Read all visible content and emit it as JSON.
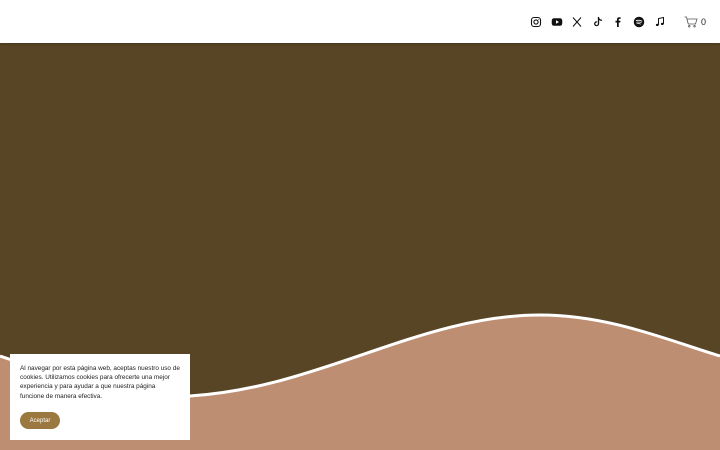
{
  "header": {
    "social_links": [
      {
        "icon": "instagram-icon"
      },
      {
        "icon": "youtube-icon"
      },
      {
        "icon": "x-twitter-icon"
      },
      {
        "icon": "tiktok-icon"
      },
      {
        "icon": "facebook-icon"
      },
      {
        "icon": "spotify-icon"
      },
      {
        "icon": "music-note-icon"
      }
    ],
    "cart": {
      "icon": "cart-icon",
      "count": "0"
    }
  },
  "hero": {
    "background_color": "#584526",
    "wave_color": "#be8e72",
    "wave_stroke_color": "#ffffff"
  },
  "cookie_banner": {
    "text": "Al navegar por esta página web, aceptas nuestro uso de cookies. Utilizamos cookies para ofrecerte una mejor experiencia y para ayudar a que nuestra página funcione de manera efectiva.",
    "accept_label": "Aceptar",
    "button_color": "#9b783f"
  }
}
